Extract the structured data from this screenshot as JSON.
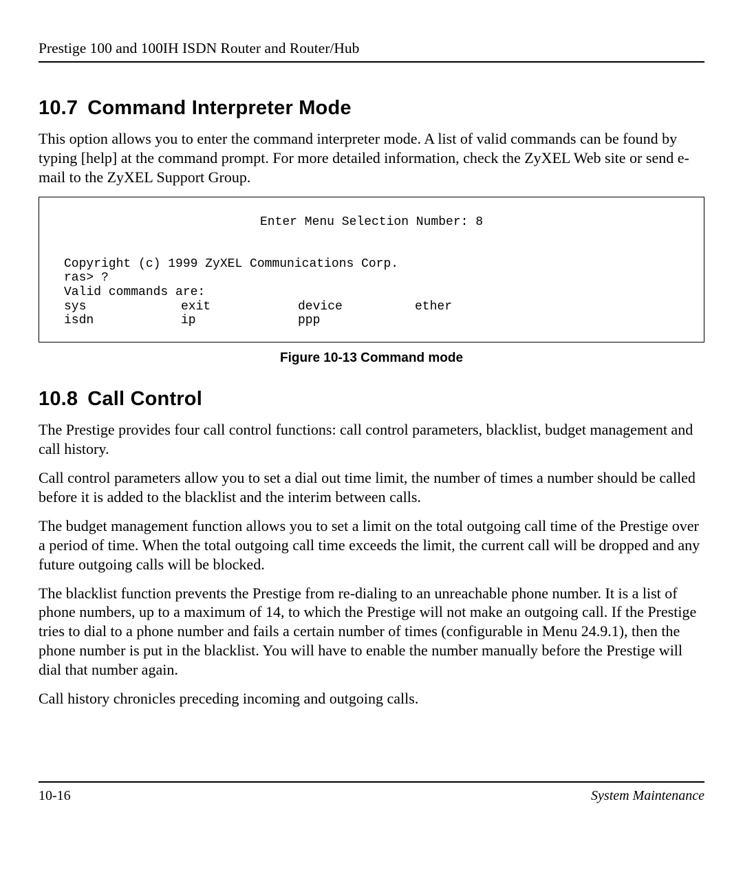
{
  "header": {
    "running": "Prestige 100 and 100IH ISDN Router and Router/Hub"
  },
  "section107": {
    "num": "10.7",
    "title": "Command Interpreter Mode",
    "para": "This option allows you to enter the command interpreter mode. A list of valid commands can be found by typing [help] at the command prompt. For more detailed information, check the ZyXEL Web site or send e-mail to the ZyXEL Support Group."
  },
  "codebox": {
    "menuLine": "Enter Menu Selection Number: 8",
    "copyright": "Copyright (c) 1999 ZyXEL Communications Corp.",
    "prompt": "ras> ?",
    "validLabel": "Valid commands are:",
    "row1": {
      "c1": "sys",
      "c2": "exit",
      "c3": "device",
      "c4": "ether"
    },
    "row2": {
      "c1": "isdn",
      "c2": "ip",
      "c3": "ppp",
      "c4": ""
    }
  },
  "figureCaption": "Figure 10-13 Command mode",
  "section108": {
    "num": "10.8",
    "title": "Call Control",
    "p1": "The Prestige provides four call control functions: call control parameters, blacklist, budget management and call history.",
    "p2": "Call control parameters allow you to set a dial out time limit, the number of times a number should be called before it is added to the blacklist and the interim between calls.",
    "p3": "The budget management function allows you to set a limit on the total outgoing call time of the Prestige over a period of time. When the total outgoing call time exceeds the limit, the current call will be dropped and any future outgoing calls will be blocked.",
    "p4": "The blacklist function prevents the Prestige from re-dialing to an unreachable phone number. It is a list of phone numbers, up to a maximum of 14, to which the Prestige will not make an outgoing call. If the Prestige tries to dial to a phone number and fails a certain number of times (configurable in Menu 24.9.1), then the phone number is put in the blacklist. You will have to enable the number manually before the Prestige will dial that number again.",
    "p5": "Call history chronicles preceding incoming and outgoing calls."
  },
  "footer": {
    "left": "10-16",
    "right": "System Maintenance"
  }
}
